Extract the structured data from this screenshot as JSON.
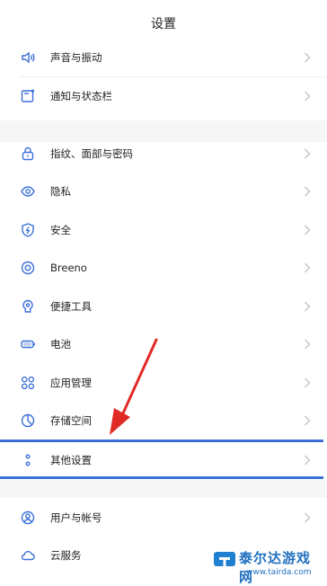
{
  "header": {
    "title": "设置"
  },
  "items": [
    {
      "label": "声音与振动",
      "icon": "speaker-icon"
    },
    {
      "label": "通知与状态栏",
      "icon": "notification-icon"
    },
    {
      "label": "指纹、面部与密码",
      "icon": "lock-icon"
    },
    {
      "label": "隐私",
      "icon": "privacy-eye-icon"
    },
    {
      "label": "安全",
      "icon": "shield-icon"
    },
    {
      "label": "Breeno",
      "icon": "breeno-icon"
    },
    {
      "label": "便捷工具",
      "icon": "tools-icon"
    },
    {
      "label": "电池",
      "icon": "battery-icon"
    },
    {
      "label": "应用管理",
      "icon": "apps-icon"
    },
    {
      "label": "存储空间",
      "icon": "storage-icon"
    },
    {
      "label": "其他设置",
      "icon": "more-settings-icon"
    },
    {
      "label": "用户与帐号",
      "icon": "user-icon"
    },
    {
      "label": "云服务",
      "icon": "cloud-icon"
    }
  ],
  "colors": {
    "highlight": "#3b6fd6",
    "arrow": "#e02a26"
  },
  "watermark": {
    "text": "泰尔达游戏网",
    "url": "www.tairda.com"
  }
}
